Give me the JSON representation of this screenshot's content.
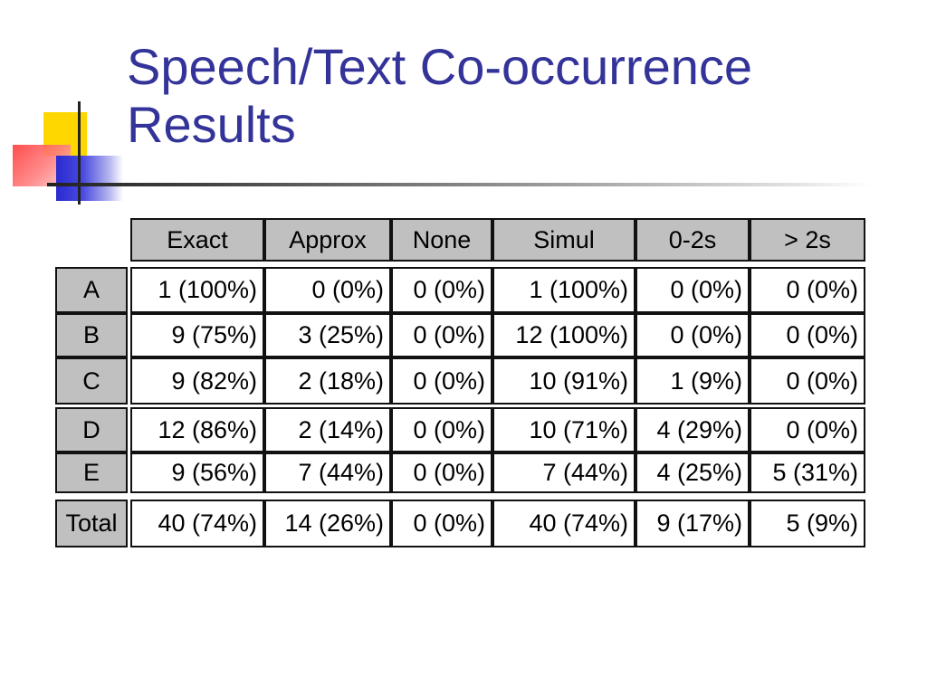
{
  "slide": {
    "title_line1": "Speech/Text Co-occurrence",
    "title_line2": "Results"
  },
  "table": {
    "columns": [
      "Exact",
      "Approx",
      "None",
      "Simul",
      "0-2s",
      "> 2s"
    ],
    "rows": [
      {
        "label": "A",
        "cells": [
          "1 (100%)",
          "0 (0%)",
          "0 (0%)",
          "1 (100%)",
          "0 (0%)",
          "0 (0%)"
        ]
      },
      {
        "label": "B",
        "cells": [
          "9 (75%)",
          "3 (25%)",
          "0 (0%)",
          "12 (100%)",
          "0 (0%)",
          "0 (0%)"
        ]
      },
      {
        "label": "C",
        "cells": [
          "9 (82%)",
          "2 (18%)",
          "0 (0%)",
          "10 (91%)",
          "1 (9%)",
          "0 (0%)"
        ]
      },
      {
        "label": "D",
        "cells": [
          "12 (86%)",
          "2 (14%)",
          "0 (0%)",
          "10 (71%)",
          "4 (29%)",
          "0 (0%)"
        ]
      },
      {
        "label": "E",
        "cells": [
          "9 (56%)",
          "7 (44%)",
          "0 (0%)",
          "7 (44%)",
          "4 (25%)",
          "5 (31%)"
        ]
      },
      {
        "label": "Total",
        "cells": [
          "40 (74%)",
          "14 (26%)",
          "0 (0%)",
          "40 (74%)",
          "9 (17%)",
          "5 (9%)"
        ]
      }
    ]
  },
  "colors": {
    "title": "#333399",
    "header_fill": "#c0c0c0",
    "accent_yellow": "#ffd700",
    "accent_red": "#ff3a3a",
    "accent_blue": "#2a2ad0"
  }
}
